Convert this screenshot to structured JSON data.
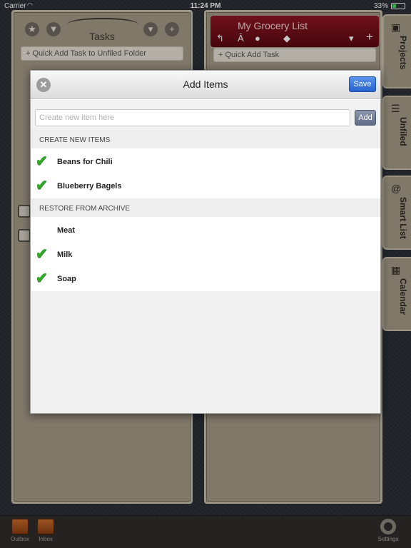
{
  "status_bar": {
    "carrier": "Carrier",
    "time": "11:24 PM",
    "battery": "33%"
  },
  "left_panel": {
    "title": "Tasks",
    "quick_add": "Quick Add Task to Unfiled Folder"
  },
  "right_panel": {
    "list_title": "My Grocery List",
    "quick_add": "Quick Add Task"
  },
  "side_tabs": [
    "Projects",
    "Unfiled",
    "Smart List",
    "Calendar"
  ],
  "toolbar": {
    "outbox": "Outbox",
    "inbox": "Inbox",
    "settings": "Settings"
  },
  "modal": {
    "title": "Add Items",
    "save_label": "Save",
    "input_placeholder": "Create new item here",
    "add_label": "Add",
    "sections": [
      {
        "header": "CREATE NEW ITEMS",
        "items": [
          {
            "label": "Beans for Chili",
            "checked": true
          },
          {
            "label": "Blueberry Bagels",
            "checked": true
          }
        ]
      },
      {
        "header": "RESTORE FROM ARCHIVE",
        "items": [
          {
            "label": "Meat",
            "checked": false
          },
          {
            "label": "Milk",
            "checked": true
          },
          {
            "label": "Soap",
            "checked": true
          }
        ]
      }
    ]
  },
  "icons": {
    "check": "checkmark-icon",
    "close": "close-circle-icon",
    "accent": "#35a82c",
    "save_color": "#2463d1",
    "list_color": "#7a0f1a"
  }
}
